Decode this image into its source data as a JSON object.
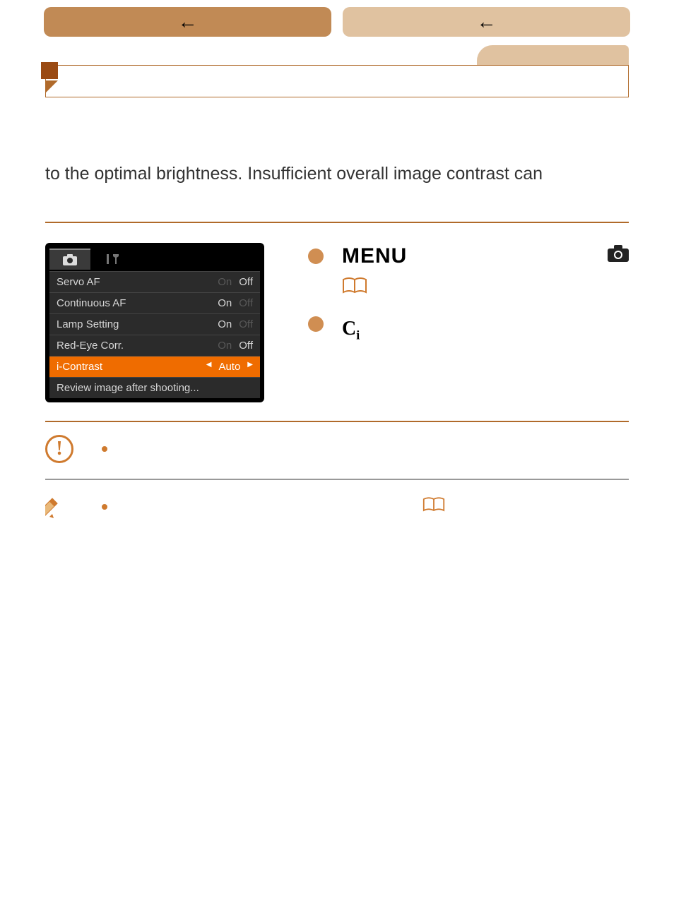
{
  "nav": {
    "left_arrow": "←",
    "right_arrow": "←"
  },
  "body_text": "to the optimal brightness. Insufficient overall image contrast can",
  "camera_menu": {
    "rows": [
      {
        "label": "Servo AF",
        "left": "On",
        "right": "Off",
        "dimLeft": true
      },
      {
        "label": "Continuous AF",
        "left": "On",
        "right": "Off",
        "dimLeft": false
      },
      {
        "label": "Lamp Setting",
        "left": "On",
        "right": "Off",
        "dimLeft": false
      },
      {
        "label": "Red-Eye Corr.",
        "left": "On",
        "right": "Off",
        "dimLeft": true
      }
    ],
    "selected": {
      "label": "i-Contrast",
      "value": "Auto"
    },
    "footer": "Review image after shooting..."
  },
  "steps": {
    "menu_label": "MENU",
    "ci_label_main": "C",
    "ci_label_sub": "i"
  }
}
